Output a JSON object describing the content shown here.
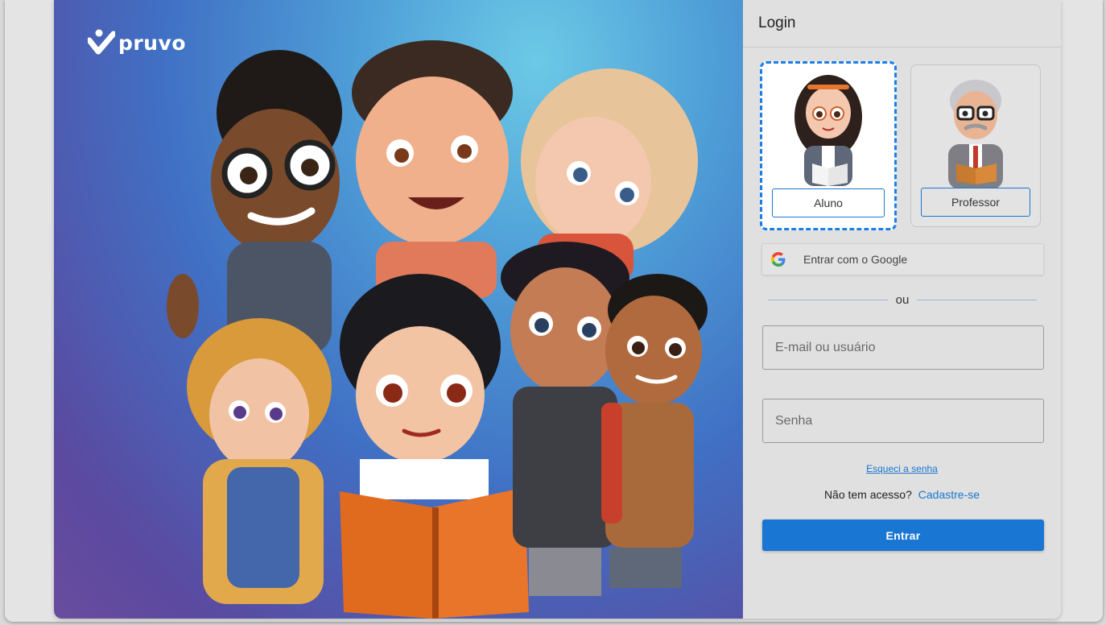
{
  "brand": {
    "name": "pruvo"
  },
  "login": {
    "title": "Login",
    "roles": [
      {
        "label": "Aluno",
        "selected": true
      },
      {
        "label": "Professor",
        "selected": false
      }
    ],
    "google_label": "Entrar com o Google",
    "or_label": "ou",
    "email_placeholder": "E-mail ou usuário",
    "password_placeholder": "Senha",
    "forgot_label": "Esqueci a senha",
    "no_access_text": "Não tem acesso?",
    "signup_label": "Cadastre-se",
    "submit_label": "Entrar"
  },
  "colors": {
    "accent": "#1976d2",
    "selected_border": "#1a7ee6",
    "panel_bg": "#e0e0e0"
  },
  "icons": [
    "pruvo-logo-icon",
    "google-icon",
    "student-avatar-icon",
    "teacher-avatar-icon"
  ]
}
